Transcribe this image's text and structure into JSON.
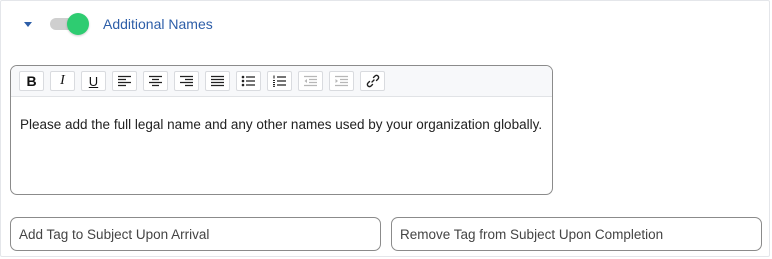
{
  "section": {
    "title": "Additional Names",
    "toggle_on": true
  },
  "colors": {
    "accent_blue": "#2d5ea8",
    "toggle_knob_green": "#2ecc71",
    "toggle_track": "#cfcfcf"
  },
  "toolbar": {
    "bold_label": "B",
    "italic_label": "I",
    "underline_label": "U",
    "icons": [
      "bold-icon",
      "italic-icon",
      "underline-icon",
      "align-left-icon",
      "align-center-icon",
      "align-right-icon",
      "align-justify-icon",
      "bulleted-list-icon",
      "numbered-list-icon",
      "outdent-icon",
      "indent-icon",
      "link-icon"
    ]
  },
  "editor": {
    "text": "Please add the full legal name and any other names used by your organization globally."
  },
  "tags": {
    "add_placeholder": "Add Tag to Subject Upon Arrival",
    "remove_placeholder": "Remove Tag from Subject Upon Completion"
  }
}
